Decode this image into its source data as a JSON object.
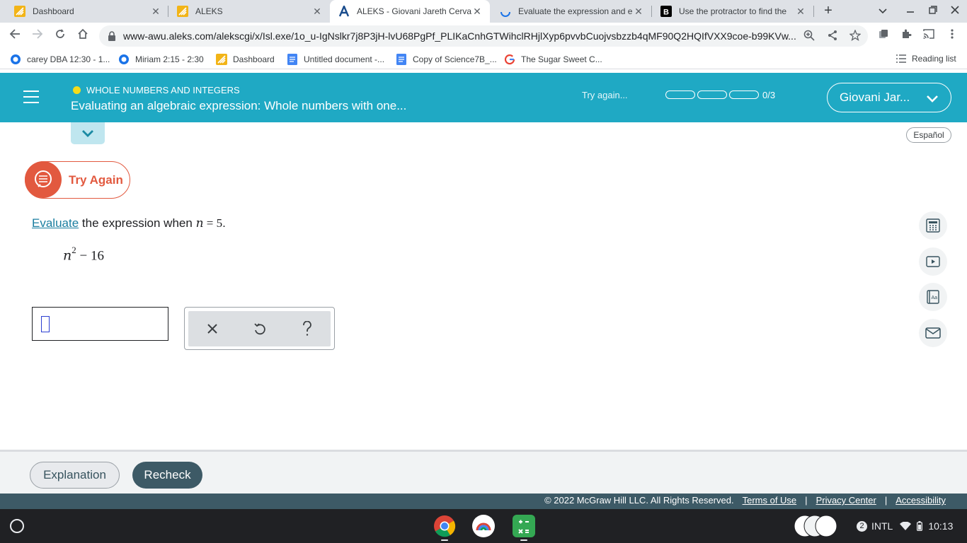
{
  "browser": {
    "tabs": [
      {
        "title": "Dashboard",
        "icon": "aleks-logo-icon"
      },
      {
        "title": "ALEKS",
        "icon": "aleks-logo-icon"
      },
      {
        "title": "ALEKS - Giovani Jareth Cervan",
        "icon": "aleks-a-icon"
      },
      {
        "title": "Evaluate the expression and e",
        "icon": "loading-spinner-icon"
      },
      {
        "title": "Use the protractor to find the",
        "icon": "brainly-b-icon"
      }
    ],
    "url": "www-awu.aleks.com/alekscgi/x/Isl.exe/1o_u-IgNslkr7j8P3jH-lvU68PgPf_PLIKaCnhGTWihclRHjlXyp6pvvbCuojvsbzzb4qMF90Q2HQIfVXX9coe-b99KVw..."
  },
  "bookmarks": [
    {
      "label": "carey DBA 12:30 - 1...",
      "icon": "blue-circle-icon"
    },
    {
      "label": "Miriam 2:15 - 2:30",
      "icon": "blue-circle-icon"
    },
    {
      "label": "Dashboard",
      "icon": "aleks-logo-icon"
    },
    {
      "label": "Untitled document -...",
      "icon": "google-docs-icon"
    },
    {
      "label": "Copy of Science7B_...",
      "icon": "google-docs-icon"
    },
    {
      "label": "The Sugar Sweet C...",
      "icon": "google-g-icon"
    }
  ],
  "reading_list": "Reading list",
  "header": {
    "topic": "WHOLE NUMBERS AND INTEGERS",
    "lesson": "Evaluating an algebraic expression: Whole numbers with one...",
    "status": "Try again...",
    "progress": {
      "filled": 0,
      "total": 3,
      "label": "0/3"
    },
    "user": "Giovani Jar..."
  },
  "content": {
    "language": "Español",
    "try_again": "Try Again",
    "question": {
      "link": "Evaluate",
      "text_before_var": " the expression when ",
      "variable": "n",
      "equals": " = ",
      "value": "5",
      "period": "."
    },
    "expression": {
      "base": "n",
      "exponent": "2",
      "rest": " − 16"
    },
    "answer_value": ""
  },
  "footer": {
    "explanation": "Explanation",
    "recheck": "Recheck",
    "copyright": "© 2022 McGraw Hill LLC. All Rights Reserved.",
    "terms": "Terms of Use",
    "sep": "|",
    "privacy": "Privacy Center",
    "accessibility": "Accessibility"
  },
  "shelf": {
    "notification_count": "2",
    "input_method": "INTL",
    "time": "10:13"
  },
  "colors": {
    "aleks_teal": "#1fa9c4",
    "try_again_red": "#e2593f",
    "footer_dark": "#3d5a66",
    "link_blue": "#1a7ea0"
  }
}
